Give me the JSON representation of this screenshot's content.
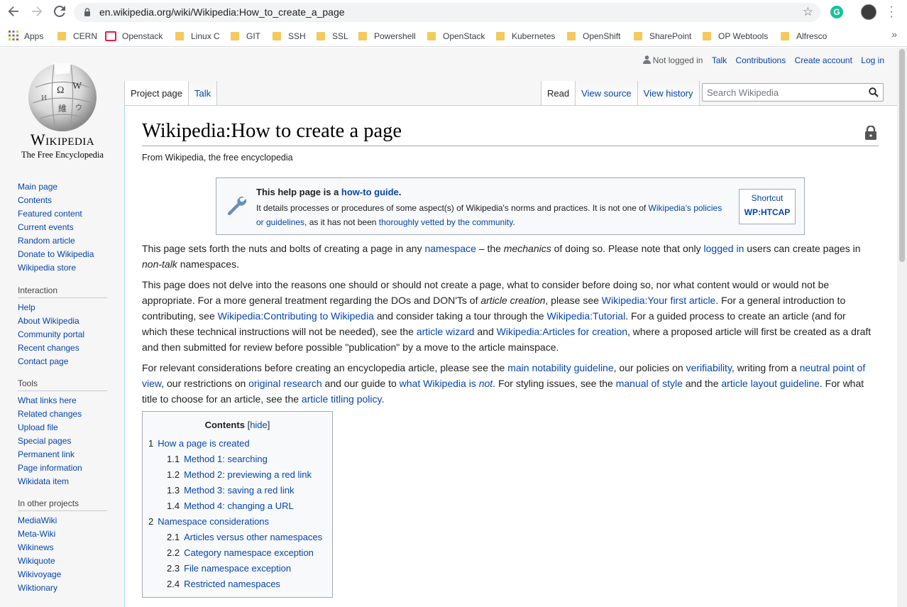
{
  "browser": {
    "url": "en.wikipedia.org/wiki/Wikipedia:How_to_create_a_page",
    "extension_letter": "G",
    "bookmarks": [
      "Apps",
      "CERN",
      "Openstack",
      "Linux C",
      "GIT",
      "SSH",
      "SSL",
      "Powershell",
      "OpenStack",
      "Kubernetes",
      "OpenShift",
      "SharePoint",
      "OP Webtools",
      "Alfresco"
    ],
    "more_bookmarks": "»"
  },
  "logo": {
    "wordmark": "Wikipedia",
    "tagline": "The Free Encyclopedia"
  },
  "personal": {
    "not_logged_in": "Not logged in",
    "links": [
      "Talk",
      "Contributions",
      "Create account",
      "Log in"
    ]
  },
  "tabs": {
    "left": [
      "Project page",
      "Talk"
    ],
    "right": [
      "Read",
      "View source",
      "View history"
    ],
    "search_placeholder": "Search Wikipedia"
  },
  "sidebar": {
    "main": [
      "Main page",
      "Contents",
      "Featured content",
      "Current events",
      "Random article",
      "Donate to Wikipedia",
      "Wikipedia store"
    ],
    "interaction_heading": "Interaction",
    "interaction": [
      "Help",
      "About Wikipedia",
      "Community portal",
      "Recent changes",
      "Contact page"
    ],
    "tools_heading": "Tools",
    "tools": [
      "What links here",
      "Related changes",
      "Upload file",
      "Special pages",
      "Permanent link",
      "Page information",
      "Wikidata item"
    ],
    "other_heading": "In other projects",
    "other": [
      "MediaWiki",
      "Meta-Wiki",
      "Wikinews",
      "Wikiquote",
      "Wikivoyage",
      "Wiktionary"
    ]
  },
  "article": {
    "title": "Wikipedia:How to create a page",
    "site_sub": "From Wikipedia, the free encyclopedia",
    "hatnote": {
      "title_prefix": "This help page is a ",
      "title_link": "how-to guide",
      "title_suffix": ".",
      "body_1": "It details processes or procedures of some aspect(s) of Wikipedia's norms and practices. It is not one of ",
      "body_link_1": "Wikipedia's policies or guidelines",
      "body_2": ", as it has not been ",
      "body_link_2": "thoroughly vetted by the community",
      "body_3": ".",
      "shortcut_label": "Shortcut",
      "shortcut_value": "WP:HTCAP"
    },
    "p1": {
      "t1": "This page sets forth the nuts and bolts of creating a page in any ",
      "l1": "namespace",
      "t2": " – the ",
      "i1": "mechanics",
      "t3": " of doing so. Please note that only ",
      "l2": "logged in",
      "t4": " users can create pages in ",
      "i2": "non-talk",
      "t5": " namespaces."
    },
    "p2": {
      "t1": "This page does not delve into the reasons one should or should not create a page, what to consider before doing so, nor what content would or would not be appropriate. For a more general treatment regarding the DOs and DON'Ts of ",
      "i1": "article creation",
      "t2": ", please see ",
      "l1": "Wikipedia:Your first article",
      "t3": ". For a general introduction to contributing, see ",
      "l2": "Wikipedia:Contributing to Wikipedia",
      "t4": " and consider taking a tour through the ",
      "l3": "Wikipedia:Tutorial",
      "t5": ". For a guided process to create an article (and for which these technical instructions will not be needed), see the ",
      "l4": "article wizard",
      "t6": " and ",
      "l5": "Wikipedia:Articles for creation",
      "t7": ", where a proposed article will first be created as a draft and then submitted for review before possible \"publication\" by a move to the article mainspace."
    },
    "p3": {
      "t1": "For relevant considerations before creating an encyclopedia article, please see the ",
      "l1": "main notability guideline",
      "t2": ", our policies on ",
      "l2": "verifiability",
      "t3": ", writing from a ",
      "l3": "neutral point of view",
      "t4": ", our restrictions on ",
      "l4": "original research",
      "t5": " and our guide to ",
      "l5": "what Wikipedia is ",
      "l5i": "not",
      "t6": ". For styling issues, see the ",
      "l6": "manual of style",
      "t7": " and the ",
      "l7": "article layout guideline",
      "t8": ". For what title to choose for an article, see the ",
      "l8": "article titling policy",
      "t9": "."
    },
    "toc": {
      "title": "Contents",
      "hide_open": "[",
      "hide": "hide",
      "hide_close": "]",
      "items": [
        {
          "num": "1",
          "label": "How a page is created",
          "level": 1
        },
        {
          "num": "1.1",
          "label": "Method 1: searching",
          "level": 2
        },
        {
          "num": "1.2",
          "label": "Method 2: previewing a red link",
          "level": 2
        },
        {
          "num": "1.3",
          "label": "Method 3: saving a red link",
          "level": 2
        },
        {
          "num": "1.4",
          "label": "Method 4: changing a URL",
          "level": 2
        },
        {
          "num": "2",
          "label": "Namespace considerations",
          "level": 1
        },
        {
          "num": "2.1",
          "label": "Articles versus other namespaces",
          "level": 2
        },
        {
          "num": "2.2",
          "label": "Category namespace exception",
          "level": 2
        },
        {
          "num": "2.3",
          "label": "File namespace exception",
          "level": 2
        },
        {
          "num": "2.4",
          "label": "Restricted namespaces",
          "level": 2
        }
      ]
    }
  }
}
